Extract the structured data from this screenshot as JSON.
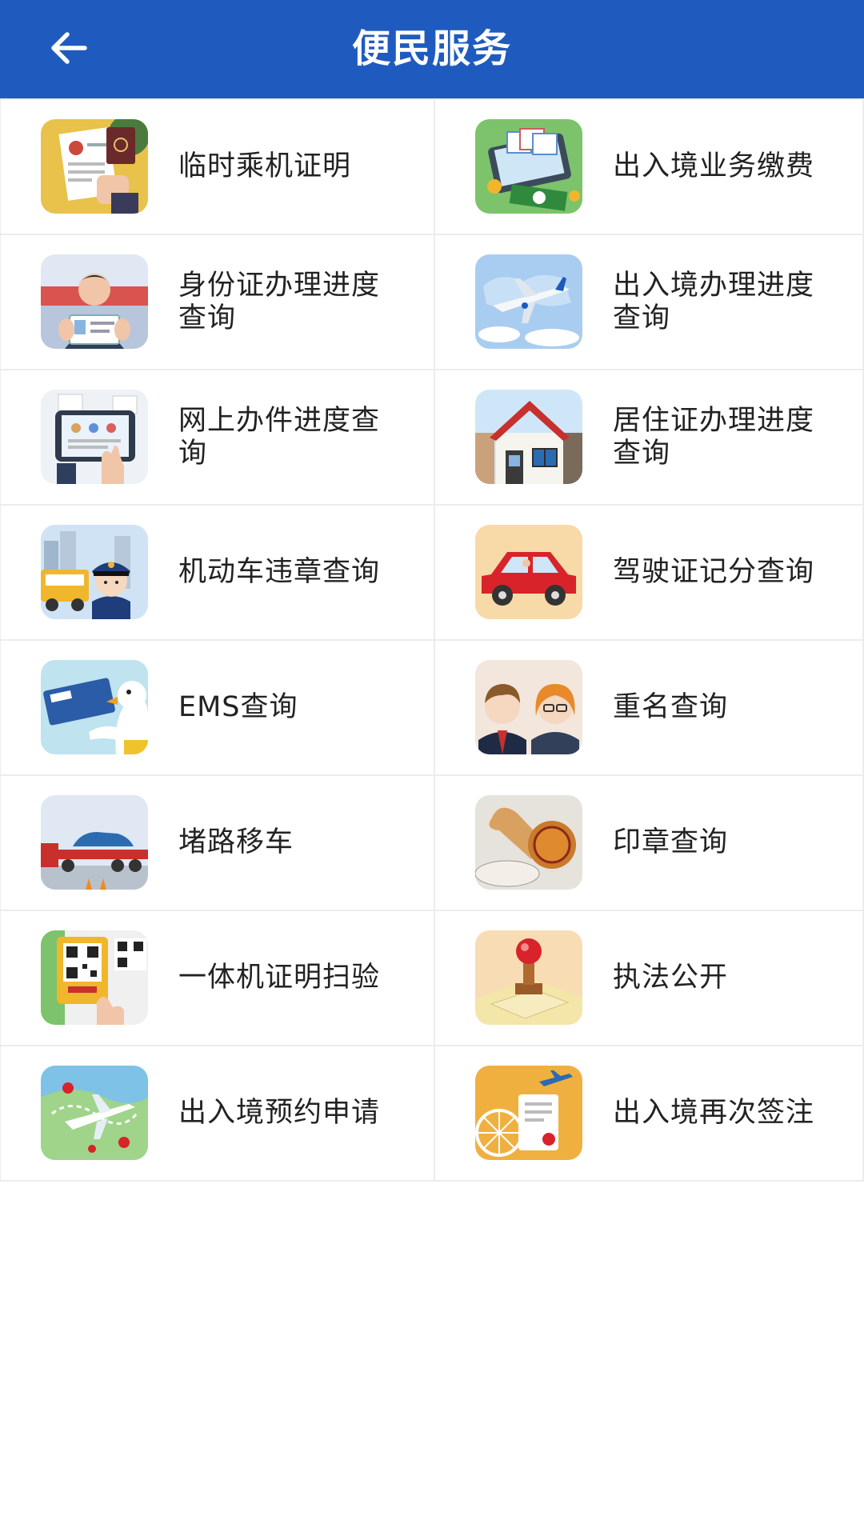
{
  "header": {
    "title": "便民服务",
    "back_icon": "arrow-left-icon",
    "color": "#1f5bbf"
  },
  "services": [
    {
      "label": "临时乘机证明",
      "icon": "boarding-certificate-icon"
    },
    {
      "label": "出入境业务缴费",
      "icon": "payment-icon"
    },
    {
      "label": "身份证办理进度查询",
      "icon": "id-card-progress-icon"
    },
    {
      "label": "出入境办理进度查询",
      "icon": "airplane-progress-icon"
    },
    {
      "label": "网上办件进度查询",
      "icon": "online-tablet-icon"
    },
    {
      "label": "居住证办理进度查询",
      "icon": "house-icon"
    },
    {
      "label": "机动车违章查询",
      "icon": "traffic-police-icon"
    },
    {
      "label": "驾驶证记分查询",
      "icon": "car-icon"
    },
    {
      "label": "EMS查询",
      "icon": "ems-duck-icon"
    },
    {
      "label": "重名查询",
      "icon": "people-icon"
    },
    {
      "label": "堵路移车",
      "icon": "tow-truck-icon"
    },
    {
      "label": "印章查询",
      "icon": "stamp-secret-icon"
    },
    {
      "label": "一体机证明扫验",
      "icon": "qr-scan-icon"
    },
    {
      "label": "执法公开",
      "icon": "rubber-stamp-icon"
    },
    {
      "label": "出入境预约申请",
      "icon": "globe-plane-icon"
    },
    {
      "label": "出入境再次签注",
      "icon": "ferris-wheel-icon"
    }
  ]
}
